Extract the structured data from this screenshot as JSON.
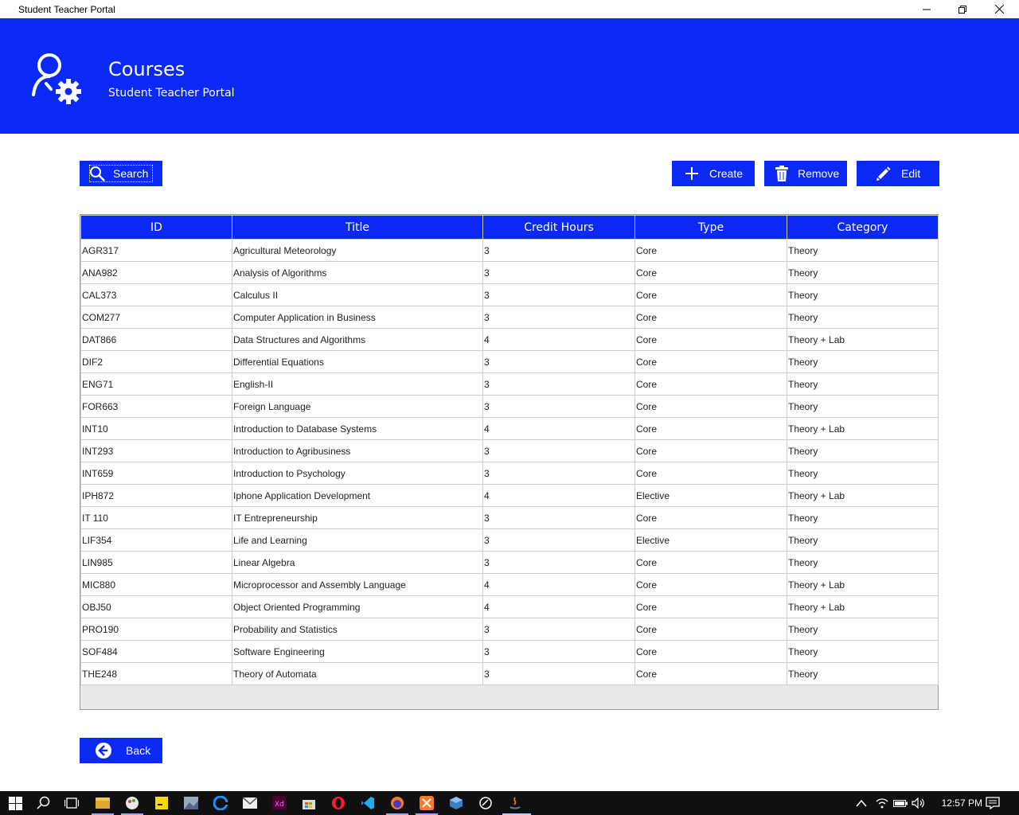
{
  "window": {
    "title": "Student Teacher Portal"
  },
  "header": {
    "title": "Courses",
    "subtitle": "Student Teacher Portal"
  },
  "toolbar": {
    "search_label": "Search",
    "create_label": "Create",
    "remove_label": "Remove",
    "edit_label": "Edit"
  },
  "table": {
    "columns": [
      "ID",
      "Title",
      "Credit Hours",
      "Type",
      "Category"
    ],
    "rows": [
      [
        "AGR317",
        "Agricultural Meteorology",
        "3",
        "Core",
        "Theory"
      ],
      [
        "ANA982",
        "Analysis of Algorithms",
        "3",
        "Core",
        "Theory"
      ],
      [
        "CAL373",
        "Calculus II",
        "3",
        "Core",
        "Theory"
      ],
      [
        "COM277",
        "Computer Application in Business",
        "3",
        "Core",
        "Theory"
      ],
      [
        "DAT866",
        "Data Structures and Algorithms",
        "4",
        "Core",
        "Theory + Lab"
      ],
      [
        "DIF2",
        "Differential Equations",
        "3",
        "Core",
        "Theory"
      ],
      [
        "ENG71",
        "English-II",
        "3",
        "Core",
        "Theory"
      ],
      [
        "FOR663",
        "Foreign Language",
        "3",
        "Core",
        "Theory"
      ],
      [
        "INT10",
        "Introduction to Database Systems",
        "4",
        "Core",
        "Theory + Lab"
      ],
      [
        "INT293",
        "Introduction to Agribusiness",
        "3",
        "Core",
        "Theory"
      ],
      [
        "INT659",
        "Introduction to Psychology",
        "3",
        "Core",
        "Theory"
      ],
      [
        "IPH872",
        "Iphone Application Development",
        "4",
        "Elective",
        "Theory + Lab"
      ],
      [
        "IT 110",
        "IT Entrepreneurship",
        "3",
        "Core",
        "Theory"
      ],
      [
        "LIF354",
        "Life and Learning",
        "3",
        "Elective",
        "Theory"
      ],
      [
        "LIN985",
        "Linear Algebra",
        "3",
        "Core",
        "Theory"
      ],
      [
        "MIC880",
        "Microprocessor and Assembly Language",
        "4",
        "Core",
        "Theory + Lab"
      ],
      [
        "OBJ50",
        "Object Oriented Programming",
        "4",
        "Core",
        "Theory + Lab"
      ],
      [
        "PRO190",
        "Probability and Statistics",
        "3",
        "Core",
        "Theory"
      ],
      [
        "SOF484",
        "Software Engineering",
        "3",
        "Core",
        "Theory"
      ],
      [
        "THE248",
        "Theory of Automata",
        "3",
        "Core",
        "Theory"
      ]
    ]
  },
  "footer": {
    "back_label": "Back"
  },
  "taskbar": {
    "time": "12:57 PM"
  },
  "colors": {
    "accent": "#0b29f5"
  }
}
